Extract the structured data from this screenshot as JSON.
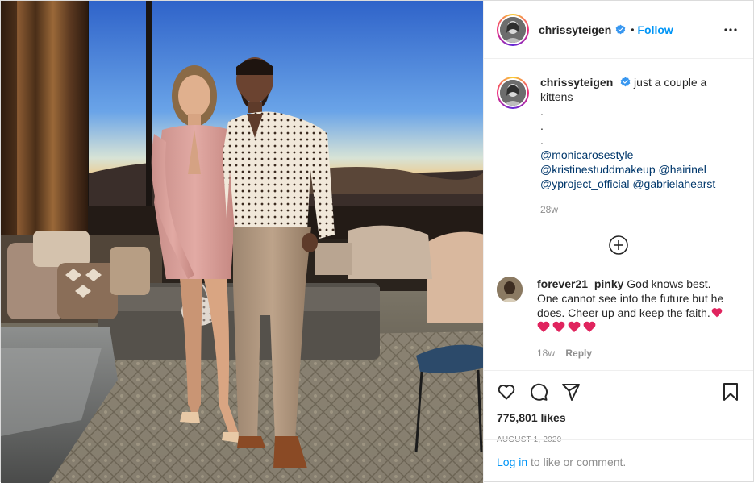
{
  "post": {
    "author": "chrissyteigen",
    "follow_label": "Follow",
    "separator": "•",
    "caption": {
      "text": "just a couple a kittens",
      "dots": [
        ".",
        ".",
        "."
      ],
      "mention_1": "@monicarosestyle",
      "mention_2": "@kristinestuddmakeup",
      "mention_3": "@hairinel",
      "mention_4": "@yproject_official",
      "mention_5": "@gabrielahearst",
      "age": "28w"
    },
    "comment": {
      "author": "forever21_pinky",
      "text": "God knows best. One cannot see into the future but he does. Cheer up and keep the faith.",
      "age": "18w",
      "reply_label": "Reply"
    },
    "likes": "775,801 likes",
    "date": "AUGUST 1, 2020",
    "login": {
      "link": "Log in",
      "rest": " to like or comment."
    }
  },
  "icons": {
    "verified": "verified-badge-icon",
    "more": "more-options-icon",
    "load_more": "plus-circle-icon",
    "like": "heart-icon",
    "comment": "comment-icon",
    "share": "paper-plane-icon",
    "save": "bookmark-icon",
    "hearts": "red-heart-emoji"
  },
  "colors": {
    "accent": "#0095f6",
    "mention": "#00376b",
    "muted": "#8e8e8e",
    "text": "#262626",
    "verified": "#3897f0",
    "heart": "#e0245e"
  }
}
